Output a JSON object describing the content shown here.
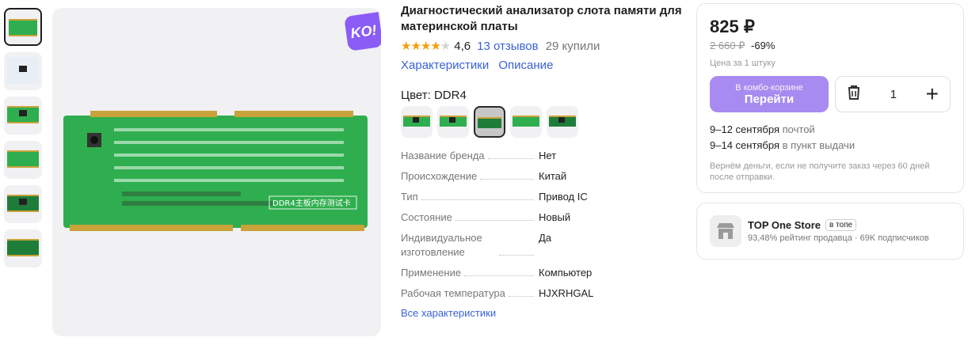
{
  "gallery": {
    "thumbnails": [
      "thumb-1",
      "thumb-2",
      "thumb-3",
      "thumb-4",
      "thumb-5",
      "thumb-6"
    ],
    "badge": "KO!",
    "board_label": "DDR4主板内存测试卡"
  },
  "product": {
    "title": "Диагностический анализатор слота памяти для материнской платы",
    "rating": "4,6",
    "reviews": "13 отзывов",
    "bought": "29 купили",
    "links": [
      "Характеристики",
      "Описание"
    ],
    "color_label": "Цвет: DDR4",
    "specs": [
      {
        "key": "Название бренда",
        "value": "Нет"
      },
      {
        "key": "Происхождение",
        "value": "Китай"
      },
      {
        "key": "Тип",
        "value": "Привод IC"
      },
      {
        "key": "Состояние",
        "value": "Новый"
      },
      {
        "key": "Индивидуальное изготовление",
        "value": "Да"
      },
      {
        "key": "Применение",
        "value": "Компьютер"
      },
      {
        "key": "Рабочая температура",
        "value": "HJXRHGAL"
      }
    ],
    "all_specs_link": "Все характеристики"
  },
  "purchase": {
    "price": "825 ₽",
    "old_price": "2 660 ₽",
    "discount": "-69%",
    "unit_note": "Цена за 1 штуку",
    "buy_small": "В комбо-корзине",
    "buy_big": "Перейти",
    "quantity": "1",
    "delivery": [
      {
        "date": "9–12 сентября",
        "method": "почтой"
      },
      {
        "date": "9–14 сентября",
        "method": "в пункт выдачи"
      }
    ],
    "refund_note": "Вернём деньги, если не получите заказ через 60 дней после отправки."
  },
  "seller": {
    "name": "TOP One Store",
    "badge": "в топе",
    "meta": "93,48% рейтинг продавца · 69K подписчиков"
  },
  "colors": {
    "accent": "#3a62d6",
    "buy": "#a88bf0",
    "star": "#f59e0b",
    "pcb": "#2fae4f"
  }
}
